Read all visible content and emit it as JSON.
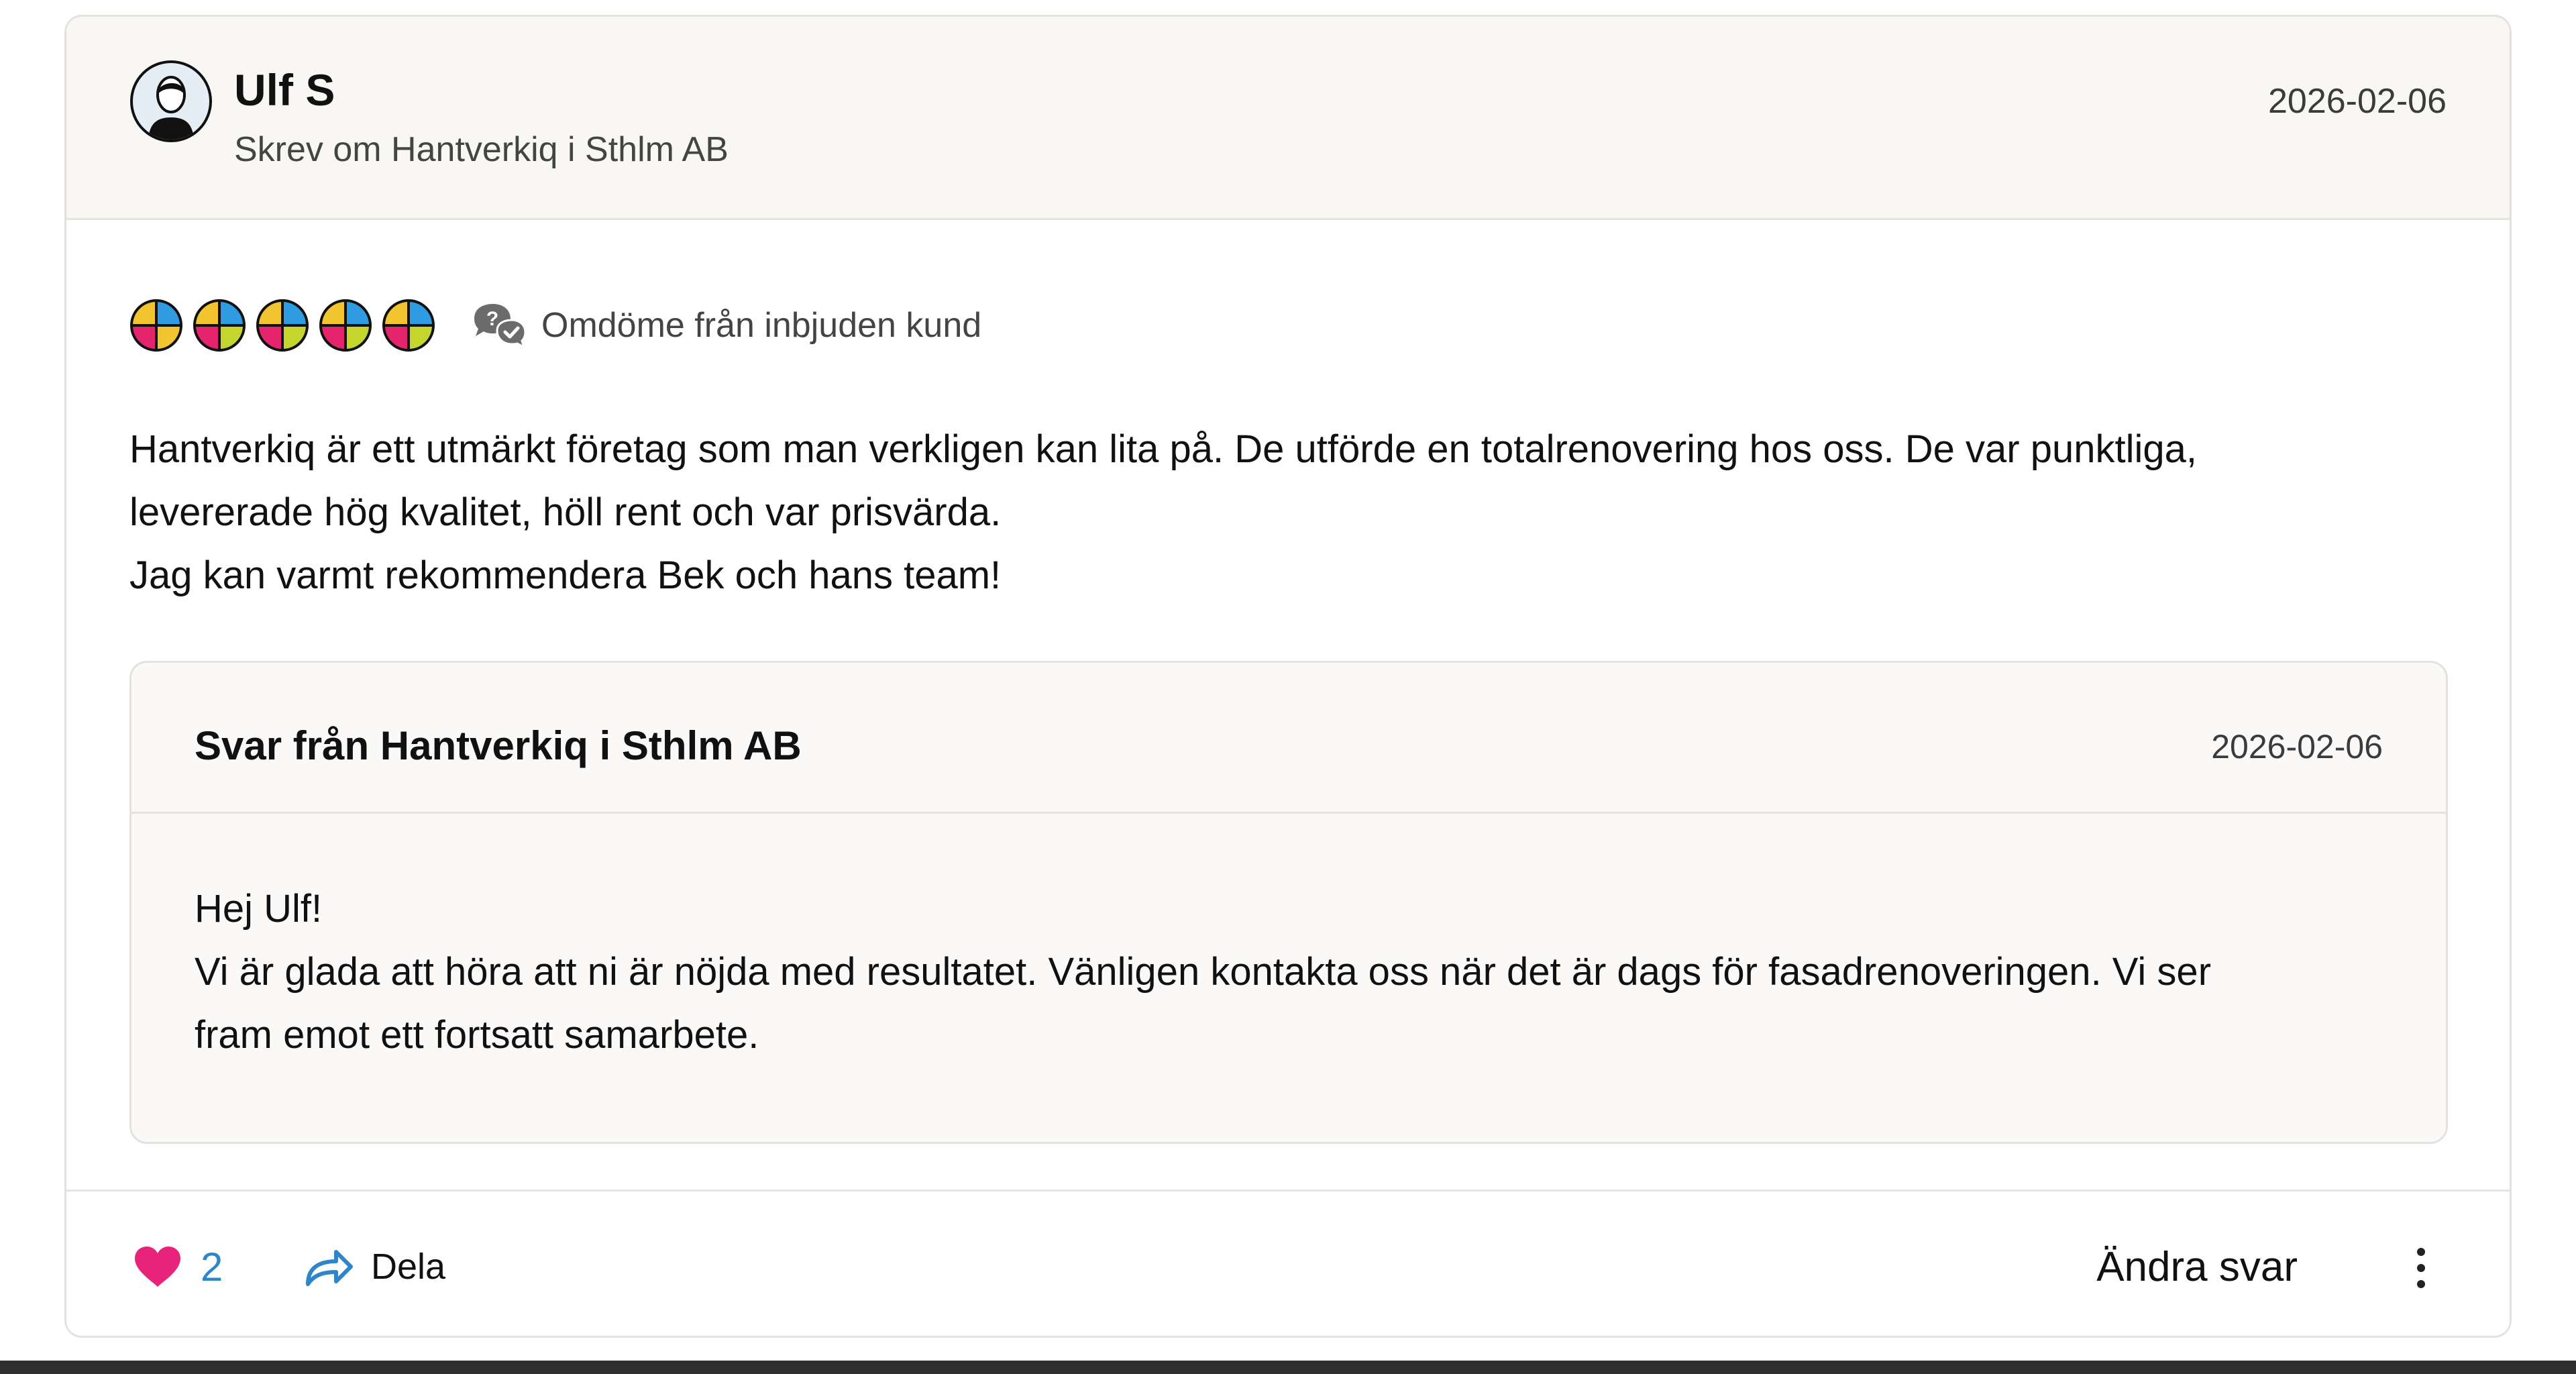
{
  "review": {
    "reviewer_name": "Ulf S",
    "reviewer_subtitle": "Skrev om Hantverkiq i Sthlm AB",
    "date": "2026-02-06",
    "rating": 5,
    "rating_max": 5,
    "invited_label": "Omdöme från inbjuden kund",
    "body": "Hantverkiq är ett utmärkt företag som man verkligen kan lita på. De utförde en totalrenovering hos oss. De var punktliga,\nlevererade hög kvalitet, höll rent och var prisvärda.\nJag kan varmt rekommendera Bek och hans team!"
  },
  "reply": {
    "title": "Svar från Hantverkiq i Sthlm AB",
    "date": "2026-02-06",
    "body": "Hej Ulf!\nVi är glada att höra att ni är nöjda med resultatet. Vänligen kontakta oss när det är dags för fasadrenoveringen. Vi ser\nfram emot ett fortsatt samarbete."
  },
  "actions": {
    "like_count": "2",
    "share_label": "Dela",
    "edit_reply_label": "Ändra svar"
  },
  "colors": {
    "like_heart": "#e8247a",
    "like_count": "#2d86c9",
    "share_icon": "#2d86c9",
    "star_yellow": "#f2c530",
    "star_blue": "#2f9be0",
    "star_pink": "#e6246e",
    "star_green": "#c5d52e"
  },
  "icons": {
    "avatar": "user-silhouette-icon",
    "star": "rating-star-icon",
    "invited": "chat-bubbles-icon",
    "like": "heart-icon",
    "share": "share-arrow-icon",
    "more": "more-vertical-icon"
  }
}
